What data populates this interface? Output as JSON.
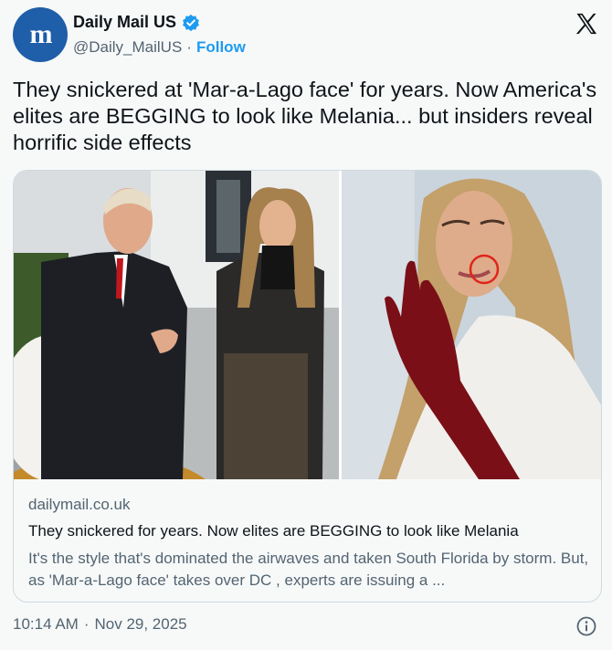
{
  "account": {
    "display_name": "Daily Mail US",
    "handle": "@Daily_MailUS",
    "separator": "·",
    "follow_label": "Follow",
    "avatar_letters": "m"
  },
  "tweet": {
    "text": "They snickered at 'Mar-a-Lago face' for years. Now America's elites are BEGGING to look like Melania... but insiders reveal horrific side effects"
  },
  "card": {
    "domain": "dailymail.co.uk",
    "title": "They snickered for years. Now elites are BEGGING to look like Melania",
    "description": "It's the style that's dominated the airwaves and taken South Florida by storm. But, as 'Mar-a-Lago face' takes over DC , experts are issuing a ..."
  },
  "footer": {
    "time": "10:14 AM",
    "separator": "·",
    "date": "Nov 29, 2025"
  },
  "icons": {
    "verified": "verified-badge-icon",
    "brand": "x-logo-icon",
    "info": "info-icon"
  },
  "colors": {
    "accent": "#1d9bf0",
    "avatar_bg": "#1f5ea8",
    "highlight_circle": "#e0241b"
  }
}
